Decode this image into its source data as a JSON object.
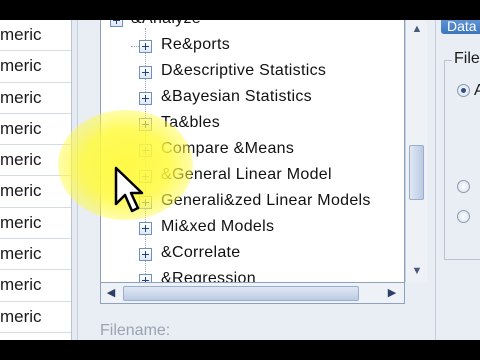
{
  "grid": {
    "cells": [
      "meric",
      "meric",
      "meric",
      "meric",
      "meric",
      "meric",
      "meric",
      "meric",
      "meric",
      "meric"
    ]
  },
  "tree": {
    "parent": "&Analyze",
    "items": [
      "Re&ports",
      "D&escriptive Statistics",
      "&Bayesian Statistics",
      "Ta&bles",
      "Compare &Means",
      "&General Linear Model",
      "Generali&zed Linear Models",
      "Mi&xed Models",
      "&Correlate",
      "&Regression"
    ]
  },
  "filename_label": "Filename:",
  "right": {
    "tab": "Data",
    "group_title": "File",
    "radio_label": "A"
  },
  "icons": {
    "expander": "plus-box-icon",
    "cursor": "arrow-cursor-icon",
    "scroll_up": "scroll-up-arrow-icon",
    "scroll_down": "scroll-down-arrow-icon",
    "scroll_left": "scroll-left-arrow-icon",
    "scroll_right": "scroll-right-arrow-icon"
  },
  "colors": {
    "tree_border": "#8ea1bd",
    "expander_plus": "#20408a",
    "highlight": "#fffa3c",
    "tab": "#3c76be"
  }
}
